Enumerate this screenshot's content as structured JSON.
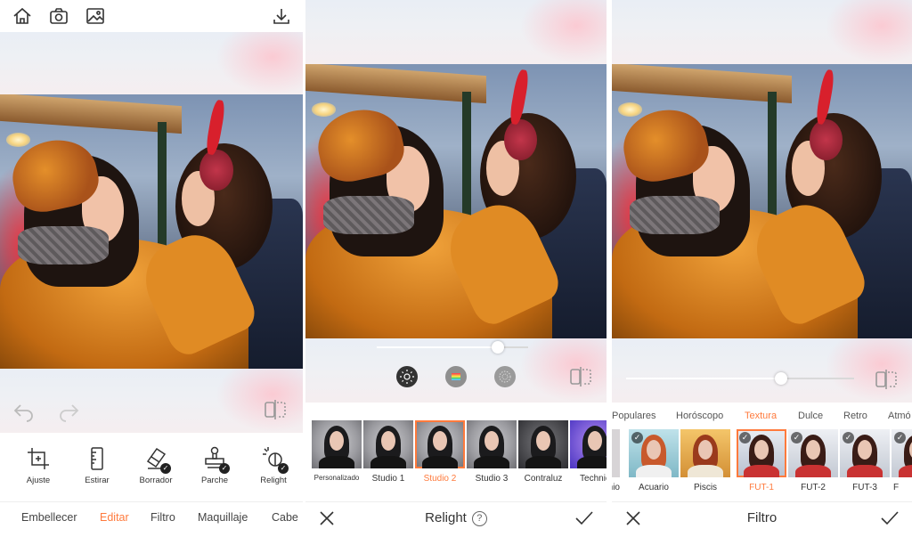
{
  "accent": "#ff7a3c",
  "editor": {
    "top_icons": [
      "home-icon",
      "camera-icon",
      "gallery-icon",
      "download-icon"
    ],
    "tools": [
      {
        "label": "Ajuste",
        "icon": "crop-icon"
      },
      {
        "label": "Estirar",
        "icon": "ruler-icon"
      },
      {
        "label": "Borrador",
        "icon": "eraser-icon",
        "checked": true
      },
      {
        "label": "Parche",
        "icon": "stamp-icon",
        "checked": true
      },
      {
        "label": "Relight",
        "icon": "relight-icon",
        "checked": true
      }
    ],
    "tabs": [
      {
        "label": "Embellecer",
        "active": false
      },
      {
        "label": "Editar",
        "active": true
      },
      {
        "label": "Filtro",
        "active": false
      },
      {
        "label": "Maquillaje",
        "active": false
      },
      {
        "label": "Cabe",
        "active": false
      }
    ]
  },
  "relight": {
    "title": "Relight",
    "help": "?",
    "slider_value": 0.8,
    "modes": [
      {
        "icon": "sun-icon",
        "selected": true
      },
      {
        "icon": "rainbow-icon",
        "selected": false
      },
      {
        "icon": "dots-icon",
        "selected": false
      }
    ],
    "presets": [
      {
        "label": "Personalizado",
        "selected": false
      },
      {
        "label": "Studio 1",
        "selected": false
      },
      {
        "label": "Studio 2",
        "selected": true
      },
      {
        "label": "Studio 3",
        "selected": false
      },
      {
        "label": "Contraluz",
        "selected": false
      },
      {
        "label": "Technic",
        "selected": false
      }
    ]
  },
  "filtro": {
    "title": "Filtro",
    "slider_value": 0.68,
    "categories": [
      {
        "label": "Populares",
        "active": false
      },
      {
        "label": "Horóscopo",
        "active": false
      },
      {
        "label": "Textura",
        "active": true
      },
      {
        "label": "Dulce",
        "active": false
      },
      {
        "label": "Retro",
        "active": false
      },
      {
        "label": "Atmó",
        "active": false
      }
    ],
    "filters": [
      {
        "label": "nio",
        "selected": false
      },
      {
        "label": "Acuario",
        "selected": false
      },
      {
        "label": "Piscis",
        "selected": false
      },
      {
        "label": "FUT-1",
        "selected": true
      },
      {
        "label": "FUT-2",
        "selected": false
      },
      {
        "label": "FUT-3",
        "selected": false
      },
      {
        "label": "F",
        "selected": false
      }
    ]
  }
}
